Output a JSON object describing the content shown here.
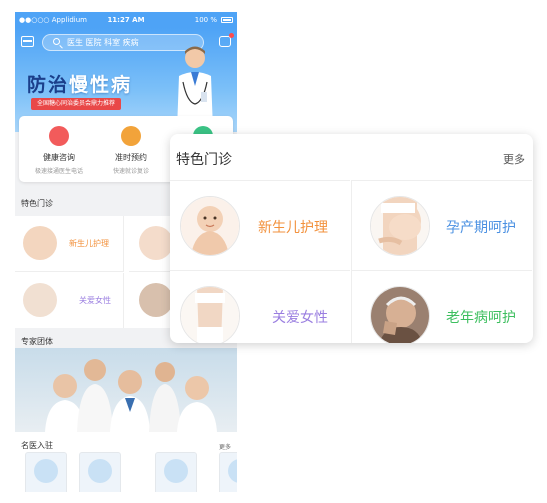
{
  "status": {
    "carrier": "●●○○○ Applidium",
    "time": "11:27 AM",
    "battery": "100 %"
  },
  "search": {
    "placeholder": "医生 医院 科室 疾病"
  },
  "banner": {
    "title_part1": "防治",
    "title_part2": "慢性病",
    "subtitle": "全国糖心同治委员会鼎力推荐"
  },
  "quick": [
    {
      "title": "健康咨询",
      "sub": "极速接通医生电话",
      "color": "#f25b5b"
    },
    {
      "title": "准时预约",
      "sub": "快速就诊复诊",
      "color": "#f2a33a"
    },
    {
      "title": "",
      "sub": "",
      "color": "#3bc486"
    }
  ],
  "section_features": {
    "title": "特色门诊",
    "more": "更多"
  },
  "features": [
    {
      "label": "新生儿护理",
      "color": "#f2913c"
    },
    {
      "label": "孕产期呵护",
      "color": "#4a90e2"
    },
    {
      "label": "关爱女性",
      "color": "#9a7ee0"
    },
    {
      "label": "老年病呵护",
      "color": "#3dbf5f"
    }
  ],
  "section_team": {
    "title": "专家团体"
  },
  "section_famous": {
    "title": "名医入驻",
    "more": "更多"
  },
  "colors": {
    "primary": "#4ea3f6",
    "accent_red": "#e94848"
  }
}
